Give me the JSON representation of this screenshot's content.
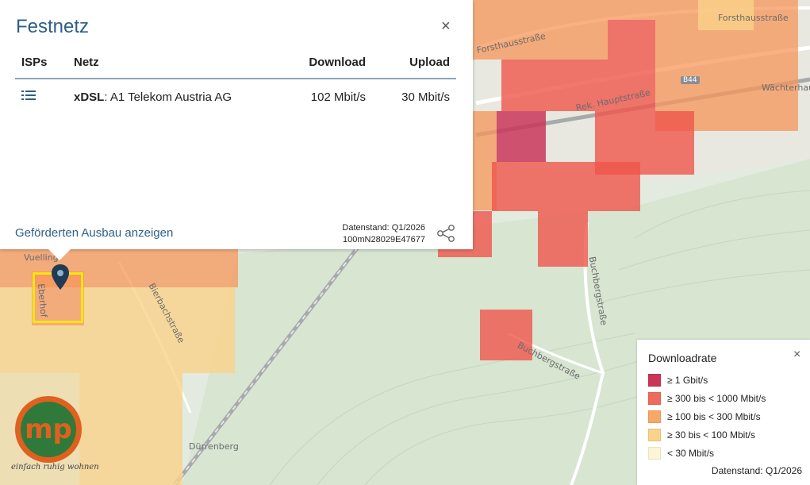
{
  "popup": {
    "title": "Festnetz",
    "close": "×",
    "columns": [
      "ISPs",
      "Netz",
      "Download",
      "Upload"
    ],
    "rows": [
      {
        "icon": "list-icon",
        "tech": "xDSL",
        "provider": ": A1 Telekom Austria AG",
        "download": "102 Mbit/s",
        "upload": "30 Mbit/s"
      }
    ],
    "link": "Geförderten Ausbau anzeigen",
    "datenstand": "Datenstand: Q1/2026",
    "cell_id": "100mN28029E47677"
  },
  "legend": {
    "title": "Downloadrate",
    "close": "×",
    "items": [
      {
        "label": "≥ 1 Gbit/s",
        "color": "#c9365a"
      },
      {
        "label": "≥ 300 bis < 1000 Mbit/s",
        "color": "#ef6a5a"
      },
      {
        "label": "≥ 100 bis < 300 Mbit/s",
        "color": "#f7a867"
      },
      {
        "label": "≥ 30 bis < 100 Mbit/s",
        "color": "#fad289"
      },
      {
        "label": "< 30 Mbit/s",
        "color": "#fdf6d6"
      }
    ],
    "datenstand": "Datenstand: Q1/2026"
  },
  "map": {
    "roads": [
      "Forsthausstraße",
      "Forsthausstraße",
      "B44",
      "Wächterhau",
      "Rek. Hauptstraße",
      "Buchbergstraße",
      "Buchbergstraße",
      "Bierbachstraße",
      "Dürrenberg",
      "Eberhof",
      "Vuelling"
    ]
  },
  "logo": {
    "letters": "mp",
    "tagline": "einfach ruhig wohnen"
  }
}
